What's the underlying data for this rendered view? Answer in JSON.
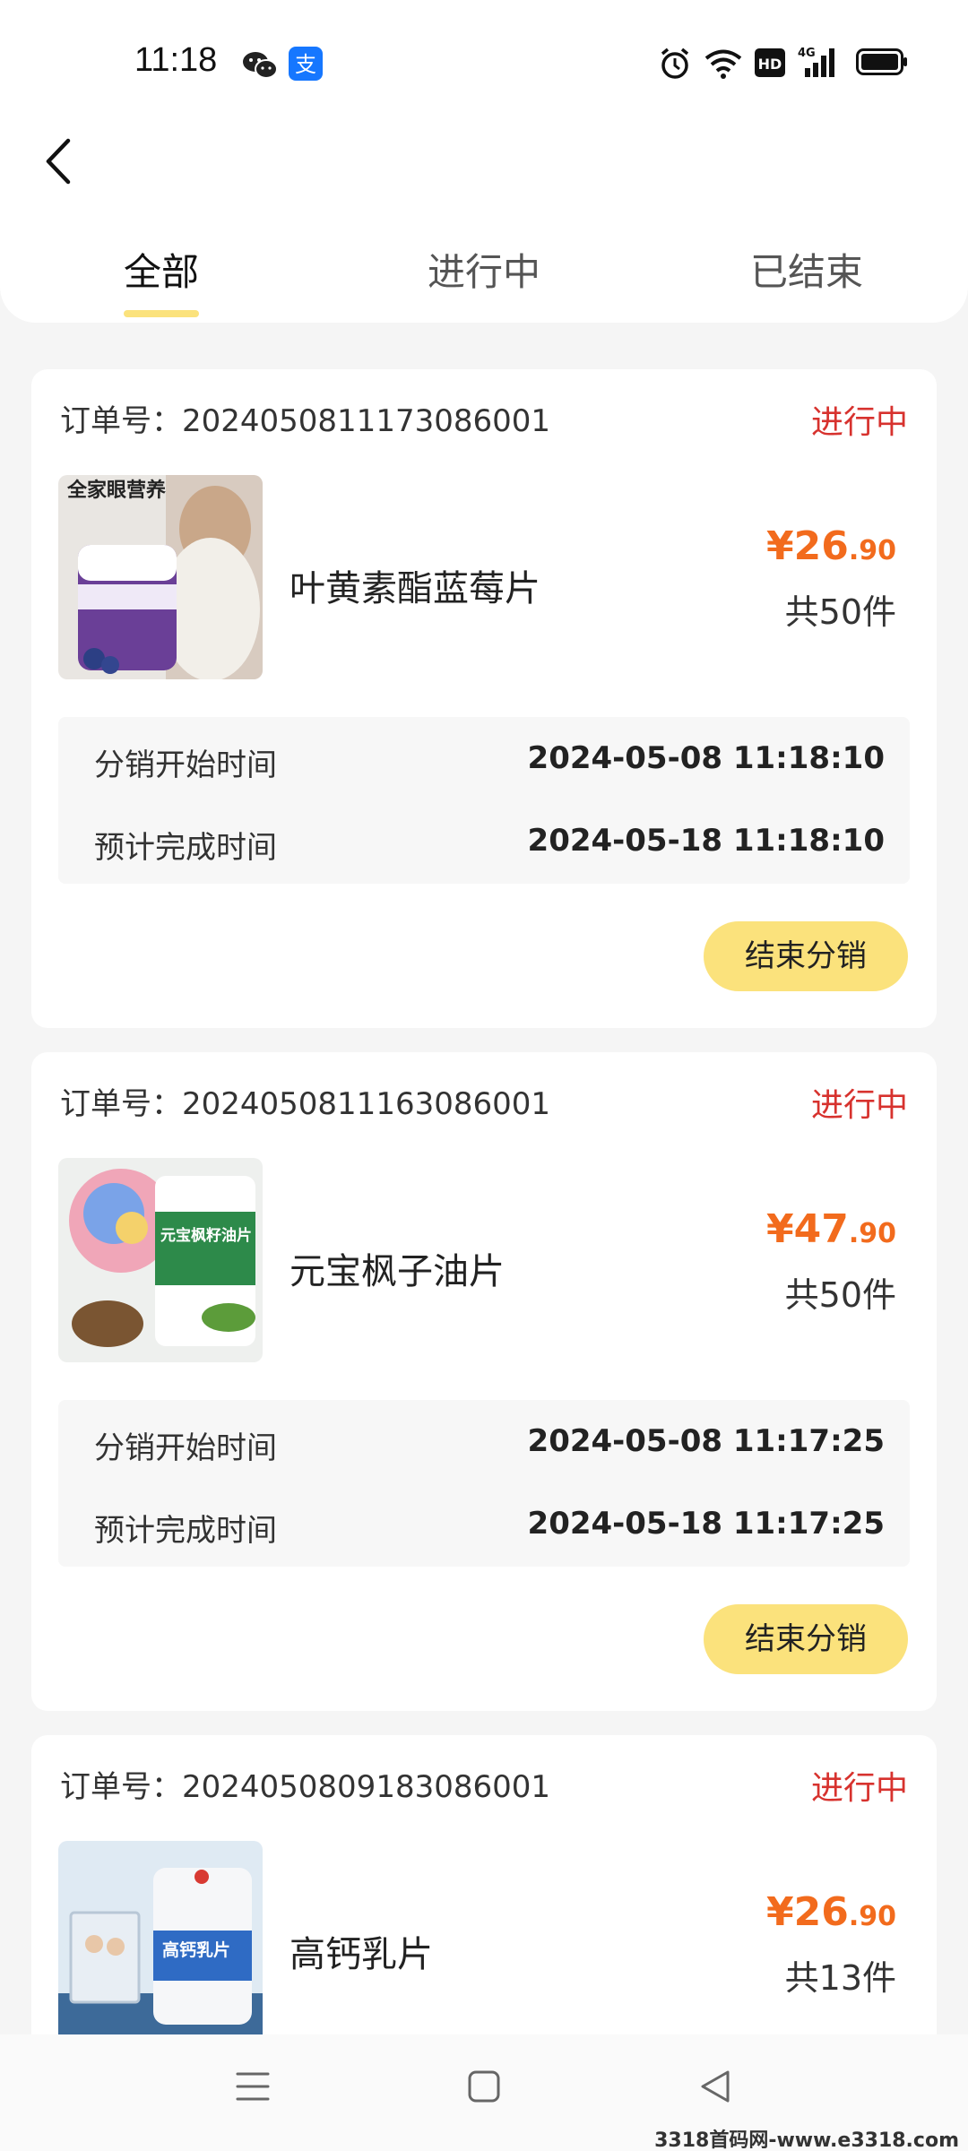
{
  "status_bar": {
    "time": "11:18"
  },
  "tabs": [
    {
      "label": "全部",
      "active": true
    },
    {
      "label": "进行中",
      "active": false
    },
    {
      "label": "已结束",
      "active": false
    }
  ],
  "orders": [
    {
      "order_label": "订单号：2024050811173086001",
      "status": "进行中",
      "product_name": "叶黄素酯蓝莓片",
      "price_main": "¥26",
      "price_decimal": ".90",
      "quantity": "共50件",
      "start_label": "分销开始时间",
      "start_time": "2024-05-08  11:18:10",
      "end_label": "预计完成时间",
      "end_time": "2024-05-18  11:18:10",
      "button": "结束分销",
      "thumb_text": "全家眼营养"
    },
    {
      "order_label": "订单号：2024050811163086001",
      "status": "进行中",
      "product_name": "元宝枫子油片",
      "price_main": "¥47",
      "price_decimal": ".90",
      "quantity": "共50件",
      "start_label": "分销开始时间",
      "start_time": "2024-05-08  11:17:25",
      "end_label": "预计完成时间",
      "end_time": "2024-05-18  11:17:25",
      "button": "结束分销",
      "thumb_text": "元宝枫籽油片"
    },
    {
      "order_label": "订单号：2024050809183086001",
      "status": "进行中",
      "product_name": "高钙乳片",
      "price_main": "¥26",
      "price_decimal": ".90",
      "quantity": "共13件",
      "thumb_text": "高钙乳片"
    }
  ],
  "watermark": "3318首码网-www.e3318.com",
  "colors": {
    "accent_yellow": "#fbe27c",
    "status_red": "#d7322e",
    "price_orange": "#f26b1d"
  }
}
